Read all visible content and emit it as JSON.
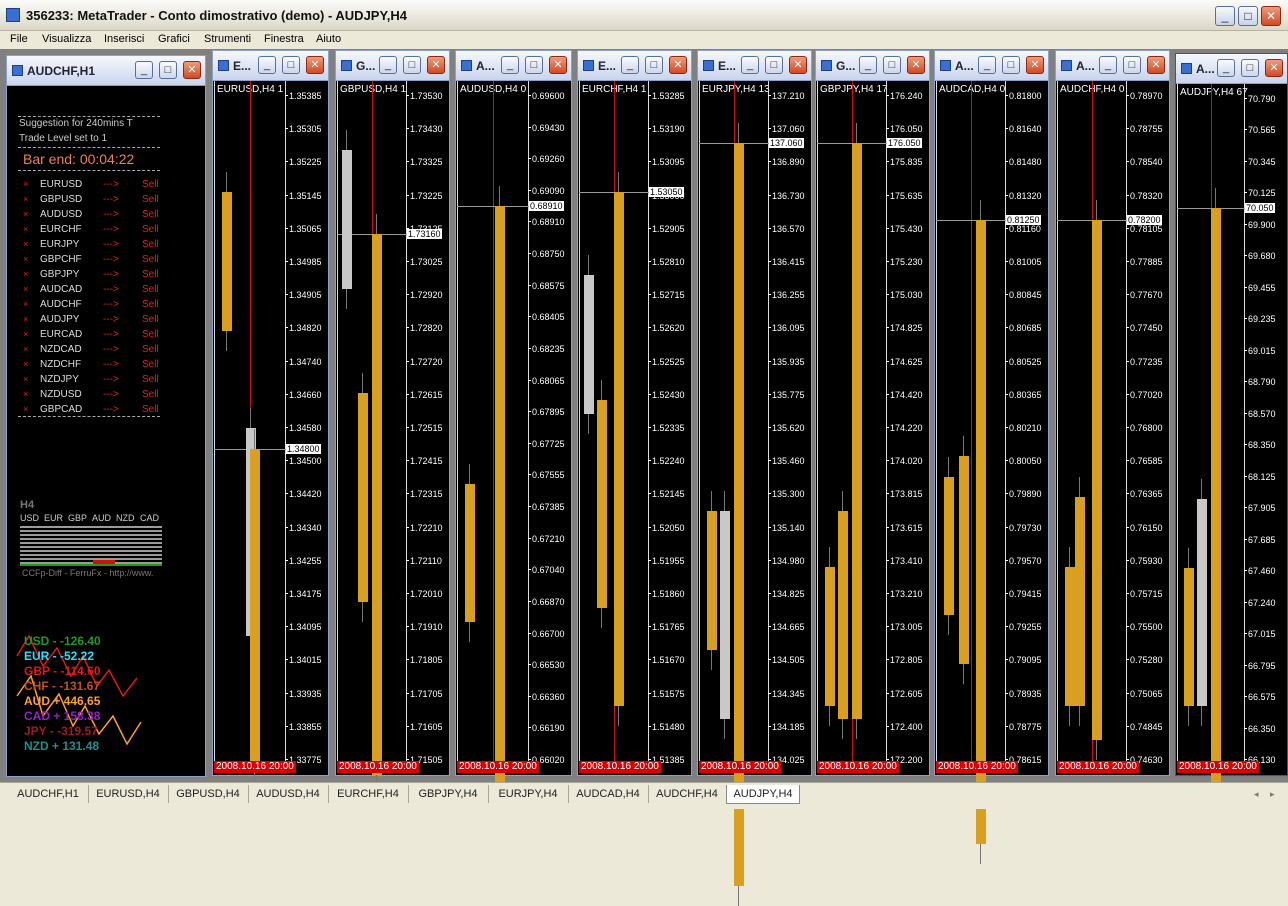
{
  "app": {
    "title": "356233: MetaTrader - Conto dimostrativo (demo) - AUDJPY,H4"
  },
  "menu": [
    "File",
    "Visualizza",
    "Inserisci",
    "Grafici",
    "Strumenti",
    "Finestra",
    "Aiuto"
  ],
  "panel": {
    "title": "AUDCHF,H1",
    "suggestion": "Suggestion for 240mins T",
    "trade_level": "Trade Level set to 1",
    "bar_end": "Bar end: 00:04:22",
    "signals": [
      {
        "pair": "EURUSD",
        "arrow": "--->",
        "action": "Sell"
      },
      {
        "pair": "GBPUSD",
        "arrow": "--->",
        "action": "Sell"
      },
      {
        "pair": "AUDUSD",
        "arrow": "--->",
        "action": "Sell"
      },
      {
        "pair": "EURCHF",
        "arrow": "--->",
        "action": "Sell"
      },
      {
        "pair": "EURJPY",
        "arrow": "--->",
        "action": "Sell"
      },
      {
        "pair": "GBPCHF",
        "arrow": "--->",
        "action": "Sell"
      },
      {
        "pair": "GBPJPY",
        "arrow": "--->",
        "action": "Sell"
      },
      {
        "pair": "AUDCAD",
        "arrow": "--->",
        "action": "Sell"
      },
      {
        "pair": "AUDCHF",
        "arrow": "--->",
        "action": "Sell"
      },
      {
        "pair": "AUDJPY",
        "arrow": "--->",
        "action": "Sell"
      },
      {
        "pair": "EURCAD",
        "arrow": "--->",
        "action": "Sell"
      },
      {
        "pair": "NZDCAD",
        "arrow": "--->",
        "action": "Sell"
      },
      {
        "pair": "NZDCHF",
        "arrow": "--->",
        "action": "Sell"
      },
      {
        "pair": "NZDJPY",
        "arrow": "--->",
        "action": "Sell"
      },
      {
        "pair": "NZDUSD",
        "arrow": "--->",
        "action": "Sell"
      },
      {
        "pair": "GBPCAD",
        "arrow": "--->",
        "action": "Sell"
      }
    ],
    "h4_label": "H4",
    "currencies_header": [
      "USD",
      "EUR",
      "GBP",
      "AUD",
      "NZD",
      "CAD"
    ],
    "ccfp_caption": "CCFp-Diff - FerruFx - http://www.",
    "strength": [
      {
        "text": "USD -  -126.40",
        "color": "#1f9a1f"
      },
      {
        "text": "EUR -  -52.22",
        "color": "#22e0ff"
      },
      {
        "text": "GBP -  -114.60",
        "color": "#e01818"
      },
      {
        "text": "CHF -  -131.67",
        "color": "#c0501a"
      },
      {
        "text": "AUD +  446.65",
        "color": "#ffa020"
      },
      {
        "text": "CAD +  158.38",
        "color": "#9a20c0"
      },
      {
        "text": "JPY -  -319.57",
        "color": "#a01a2a"
      },
      {
        "text": "NZD +  131.48",
        "color": "#208e8e"
      }
    ]
  },
  "charts": [
    {
      "title": "E...",
      "chart_label": "EURUSD,H4  1",
      "ticks": [
        "1.35385",
        "1.35305",
        "1.35225",
        "1.35145",
        "1.35065",
        "1.34985",
        "1.34905",
        "1.34820",
        "1.34740",
        "1.34660",
        "1.34580",
        "1.34500",
        "1.34420",
        "1.34340",
        "1.34255",
        "1.34175",
        "1.34095",
        "1.34015",
        "1.33935",
        "1.33855",
        "1.33775"
      ],
      "price": "1.34800",
      "date": "2008.10.16 20:00"
    },
    {
      "title": "G...",
      "chart_label": "GBPUSD,H4  1",
      "ticks": [
        "1.73530",
        "1.73430",
        "1.73325",
        "1.73225",
        "1.73125",
        "1.73025",
        "1.72920",
        "1.72820",
        "1.72720",
        "1.72615",
        "1.72515",
        "1.72415",
        "1.72315",
        "1.72210",
        "1.72110",
        "1.72010",
        "1.71910",
        "1.71805",
        "1.71705",
        "1.71605",
        "1.71505"
      ],
      "price": "1.73160",
      "date": "2008.10.16 20:00"
    },
    {
      "title": "A...",
      "chart_label": "AUDUSD,H4  0",
      "ticks": [
        "0.69600",
        "0.69430",
        "0.69260",
        "0.69090",
        "0.68910",
        "0.68750",
        "0.68575",
        "0.68405",
        "0.68235",
        "0.68065",
        "0.67895",
        "0.67725",
        "0.67555",
        "0.67385",
        "0.67210",
        "0.67040",
        "0.66870",
        "0.66700",
        "0.66530",
        "0.66360",
        "0.66190",
        "0.66020"
      ],
      "price": "0.68910",
      "date": "2008.10.16 20:00"
    },
    {
      "title": "E...",
      "chart_label": "EURCHF,H4  1",
      "ticks": [
        "1.53285",
        "1.53190",
        "1.53095",
        "1.53000",
        "1.52905",
        "1.52810",
        "1.52715",
        "1.52620",
        "1.52525",
        "1.52430",
        "1.52335",
        "1.52240",
        "1.52145",
        "1.52050",
        "1.51955",
        "1.51860",
        "1.51765",
        "1.51670",
        "1.51575",
        "1.51480",
        "1.51385"
      ],
      "price": "1.53050",
      "date": "2008.10.16 20:00"
    },
    {
      "title": "E...",
      "chart_label": "EURJPY,H4  13",
      "ticks": [
        "137.210",
        "137.060",
        "136.890",
        "136.730",
        "136.570",
        "136.415",
        "136.255",
        "136.095",
        "135.935",
        "135.775",
        "135.620",
        "135.460",
        "135.300",
        "135.140",
        "134.980",
        "134.825",
        "134.665",
        "134.505",
        "134.345",
        "134.185",
        "134.025"
      ],
      "price": "137.060",
      "date": "2008.10.16 20:00"
    },
    {
      "title": "G...",
      "chart_label": "GBPJPY,H4  17",
      "ticks": [
        "176.240",
        "176.050",
        "175.835",
        "175.635",
        "175.430",
        "175.230",
        "175.030",
        "174.825",
        "174.625",
        "174.420",
        "174.220",
        "174.020",
        "173.815",
        "173.615",
        "173.410",
        "173.210",
        "173.005",
        "172.805",
        "172.605",
        "172.400",
        "172.200"
      ],
      "price": "176.050",
      "date": "2008.10.16 20:00"
    },
    {
      "title": "A...",
      "chart_label": "AUDCAD,H4  0",
      "ticks": [
        "0.81800",
        "0.81640",
        "0.81480",
        "0.81320",
        "0.81160",
        "0.81005",
        "0.80845",
        "0.80685",
        "0.80525",
        "0.80365",
        "0.80210",
        "0.80050",
        "0.79890",
        "0.79730",
        "0.79570",
        "0.79415",
        "0.79255",
        "0.79095",
        "0.78935",
        "0.78775",
        "0.78615"
      ],
      "price": "0.81250",
      "date": "2008.10.16 20:00"
    },
    {
      "title": "A...",
      "chart_label": "AUDCHF,H4  0",
      "ticks": [
        "0.78970",
        "0.78755",
        "0.78540",
        "0.78320",
        "0.78105",
        "0.77885",
        "0.77670",
        "0.77450",
        "0.77235",
        "0.77020",
        "0.76800",
        "0.76585",
        "0.76365",
        "0.76150",
        "0.75930",
        "0.75715",
        "0.75500",
        "0.75280",
        "0.75065",
        "0.74845",
        "0.74630"
      ],
      "price": "0.78200",
      "date": "2008.10.16 20:00"
    },
    {
      "title": "A...",
      "chart_label": "AUDJPY,H4  67",
      "ticks": [
        "70.790",
        "70.565",
        "70.345",
        "70.125",
        "69.900",
        "69.680",
        "69.455",
        "69.235",
        "69.015",
        "68.790",
        "68.570",
        "68.350",
        "68.125",
        "67.905",
        "67.685",
        "67.460",
        "67.240",
        "67.015",
        "66.795",
        "66.575",
        "66.350",
        "66.130"
      ],
      "price": "70.050",
      "date": "2008.10.16 20:00"
    }
  ],
  "tabs": [
    "AUDCHF,H1",
    "EURUSD,H4",
    "GBPUSD,H4",
    "AUDUSD,H4",
    "EURCHF,H4",
    "GBPJPY,H4",
    "EURJPY,H4",
    "AUDCAD,H4",
    "AUDCHF,H4",
    "AUDJPY,H4"
  ],
  "active_tab": "AUDJPY,H4"
}
